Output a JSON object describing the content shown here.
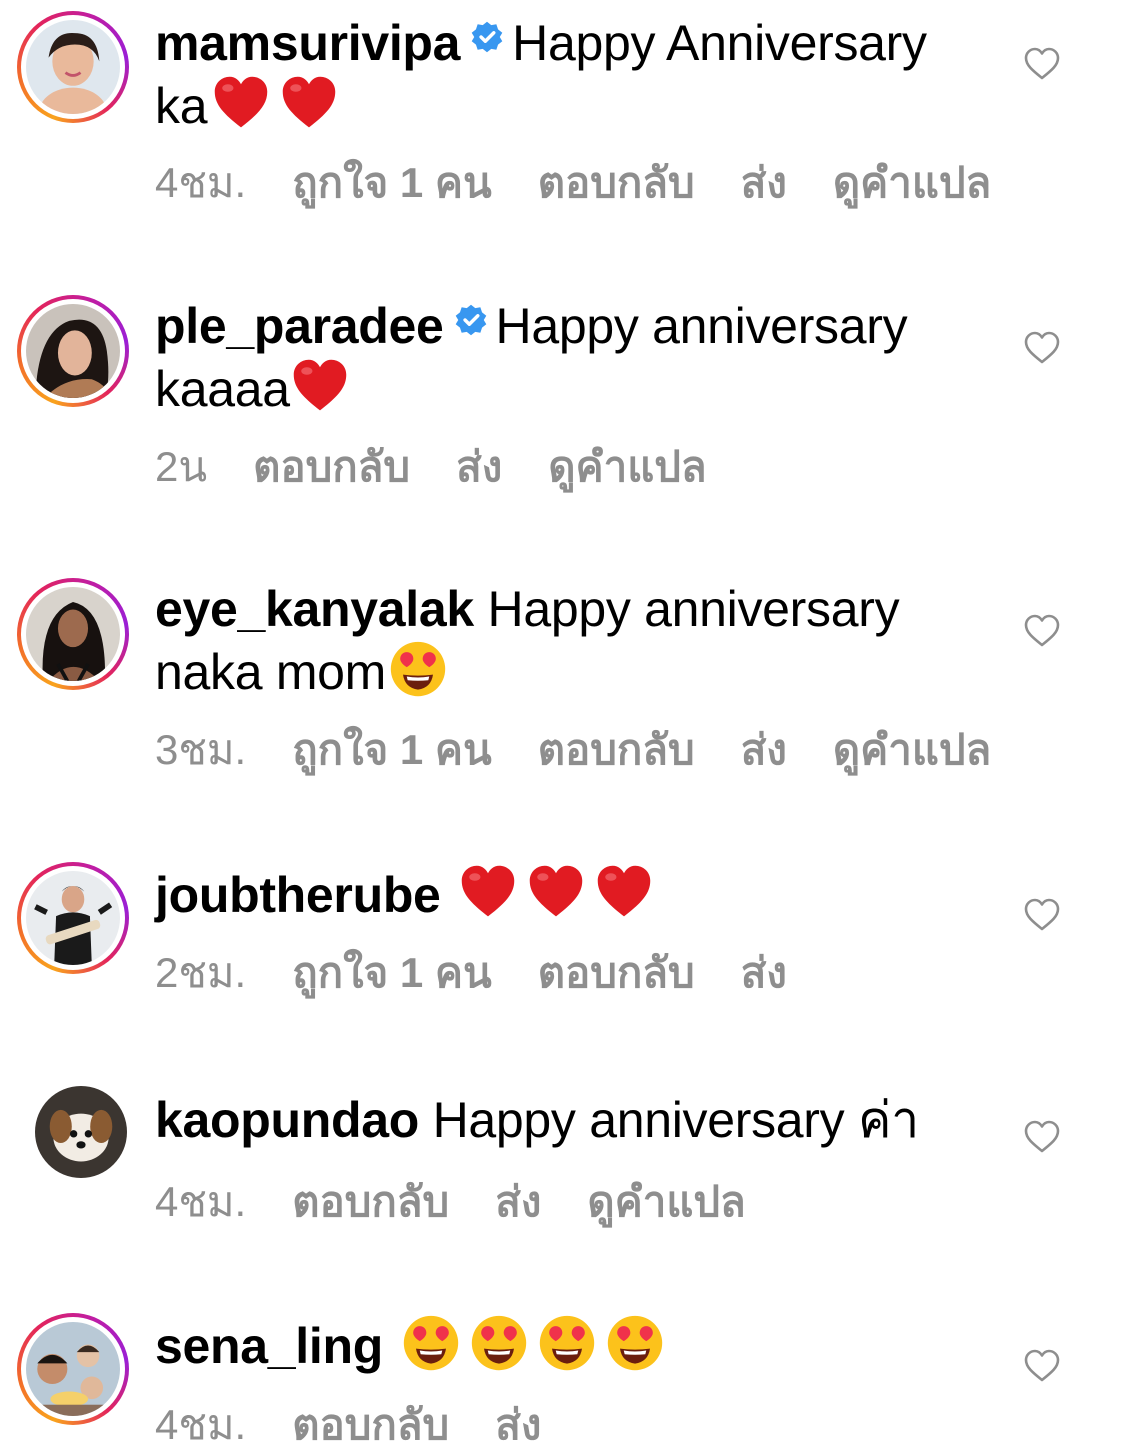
{
  "comments": [
    {
      "username": "mamsurivipa",
      "verified": true,
      "text": "Happy Anniversary ka",
      "emojis": [
        "red-heart",
        "red-heart"
      ],
      "meta": {
        "time": "4ชม.",
        "likes": "ถูกใจ 1 คน",
        "reply": "ตอบกลับ",
        "send": "ส่ง",
        "translate": "ดูคำแปล"
      }
    },
    {
      "username": "ple_paradee",
      "verified": true,
      "text": "Happy anniversary kaaaa",
      "emojis": [
        "red-heart"
      ],
      "meta": {
        "time": "2น",
        "reply": "ตอบกลับ",
        "send": "ส่ง",
        "translate": "ดูคำแปล"
      }
    },
    {
      "username": "eye_kanyalak",
      "verified": false,
      "text": "Happy anniversary naka mom",
      "emojis": [
        "heart-eyes"
      ],
      "meta": {
        "time": "3ชม.",
        "likes": "ถูกใจ 1 คน",
        "reply": "ตอบกลับ",
        "send": "ส่ง",
        "translate": "ดูคำแปล"
      }
    },
    {
      "username": "joubtherube",
      "verified": false,
      "text": "",
      "emojis": [
        "red-heart",
        "red-heart",
        "red-heart"
      ],
      "meta": {
        "time": "2ชม.",
        "likes": "ถูกใจ 1 คน",
        "reply": "ตอบกลับ",
        "send": "ส่ง"
      }
    },
    {
      "username": "kaopundao",
      "verified": false,
      "text": "Happy anniversary ค่า",
      "emojis": [],
      "meta": {
        "time": "4ชม.",
        "reply": "ตอบกลับ",
        "send": "ส่ง",
        "translate": "ดูคำแปล"
      }
    },
    {
      "username": "sena_ling",
      "verified": false,
      "text": "",
      "emojis": [
        "heart-eyes",
        "heart-eyes",
        "heart-eyes",
        "heart-eyes"
      ],
      "meta": {
        "time": "4ชม.",
        "reply": "ตอบกลับ",
        "send": "ส่ง"
      }
    }
  ],
  "icons": {
    "like": "heart-outline-icon",
    "verified": "verified-badge-icon"
  },
  "colors": {
    "meta_text": "#8e8e8e",
    "verified_blue": "#3897f0",
    "like_icon": "#8e8e8e"
  }
}
